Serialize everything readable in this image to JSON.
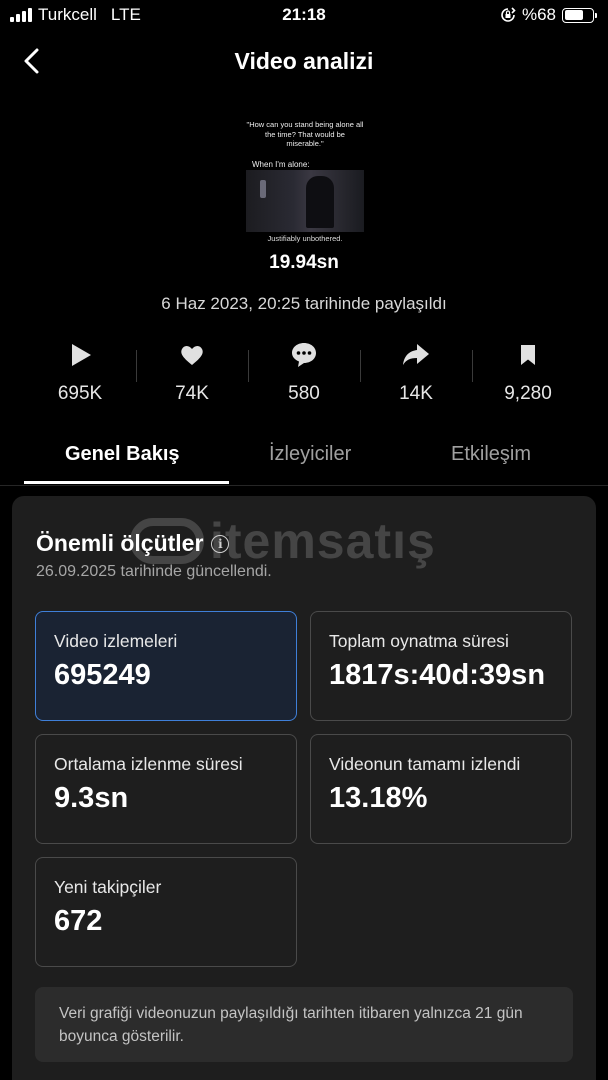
{
  "status_bar": {
    "carrier": "Turkcell",
    "network": "LTE",
    "time": "21:18",
    "battery": "%68",
    "battery_level": 0.68
  },
  "header": {
    "title": "Video analizi",
    "back_icon": "chevron-left-icon"
  },
  "video": {
    "thumbnail": {
      "quote": "\"How can you stand being alone all the time? That would be miserable.\"",
      "when_text": "When I'm alone:",
      "caption": "Justifiably unbothered."
    },
    "duration": "19.94sn",
    "shared_text": "6 Haz 2023, 20:25 tarihinde paylaşıldı"
  },
  "stats": [
    {
      "icon": "play-icon",
      "value": "695K"
    },
    {
      "icon": "heart-icon",
      "value": "74K"
    },
    {
      "icon": "comment-icon",
      "value": "580"
    },
    {
      "icon": "share-icon",
      "value": "14K"
    },
    {
      "icon": "bookmark-icon",
      "value": "9,280"
    }
  ],
  "tabs": [
    {
      "label": "Genel Bakış",
      "active": true
    },
    {
      "label": "İzleyiciler",
      "active": false
    },
    {
      "label": "Etkileşim",
      "active": false
    }
  ],
  "metrics_card": {
    "title": "Önemli ölçütler",
    "updated": "26.09.2025 tarihinde güncellendi.",
    "watermark": "itemsatış",
    "metrics": [
      {
        "label": "Video izlemeleri",
        "value": "695249",
        "selected": true
      },
      {
        "label": "Toplam oynatma süresi",
        "value": "1817s:40d:39sn",
        "selected": false
      },
      {
        "label": "Ortalama izlenme süresi",
        "value": "9.3sn",
        "selected": false
      },
      {
        "label": "Videonun tamamı izlendi",
        "value": "13.18%",
        "selected": false
      },
      {
        "label": "Yeni takipçiler",
        "value": "672",
        "selected": false
      }
    ],
    "note": "Veri grafiği videonuzun paylaşıldığı tarihten itibaren yalnızca 21 gün boyunca gösterilir."
  },
  "colors": {
    "background": "#000000",
    "card": "#1e1e1e",
    "selected_border": "#3f7fd8"
  }
}
